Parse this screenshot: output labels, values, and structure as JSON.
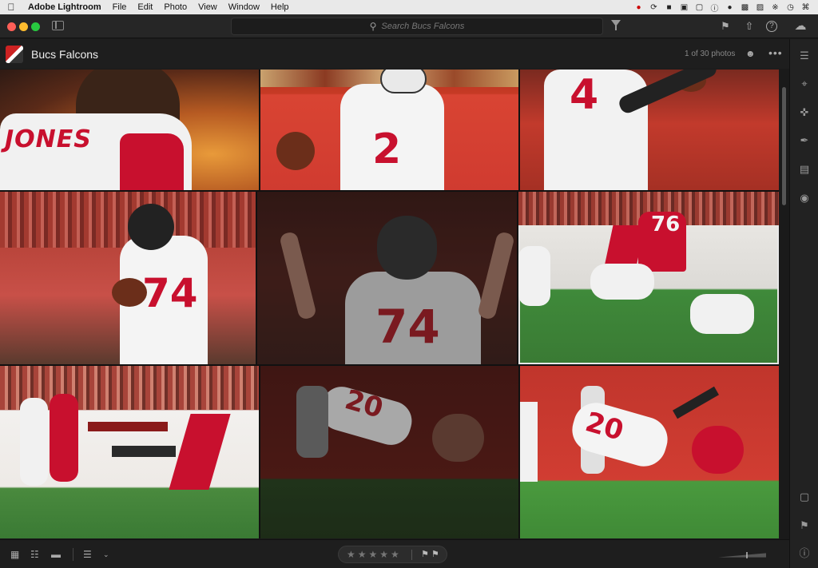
{
  "menubar": {
    "apple": "",
    "app": "Adobe Lightroom",
    "items": [
      "File",
      "Edit",
      "Photo",
      "View",
      "Window",
      "Help"
    ]
  },
  "titlebar": {
    "search_placeholder": "Search Bucs Falcons"
  },
  "album": {
    "title": "Bucs Falcons",
    "count": "1 of 30 photos"
  },
  "photos": [
    {
      "id": "p1",
      "jersey": "JONES"
    },
    {
      "id": "p2",
      "jersey": "2"
    },
    {
      "id": "p3",
      "jersey": "4"
    },
    {
      "id": "p4",
      "jersey": "74"
    },
    {
      "id": "p5",
      "jersey": "74"
    },
    {
      "id": "p6",
      "jersey": "76"
    },
    {
      "id": "p7",
      "jersey": ""
    },
    {
      "id": "p8",
      "jersey": "20"
    },
    {
      "id": "p9",
      "jersey": "20"
    }
  ],
  "bottombar": {
    "stars": "★★★★★"
  },
  "colors": {
    "accent_red": "#c8102e",
    "field_green": "#3f8a3a",
    "window_bg": "#1e1e1e"
  }
}
